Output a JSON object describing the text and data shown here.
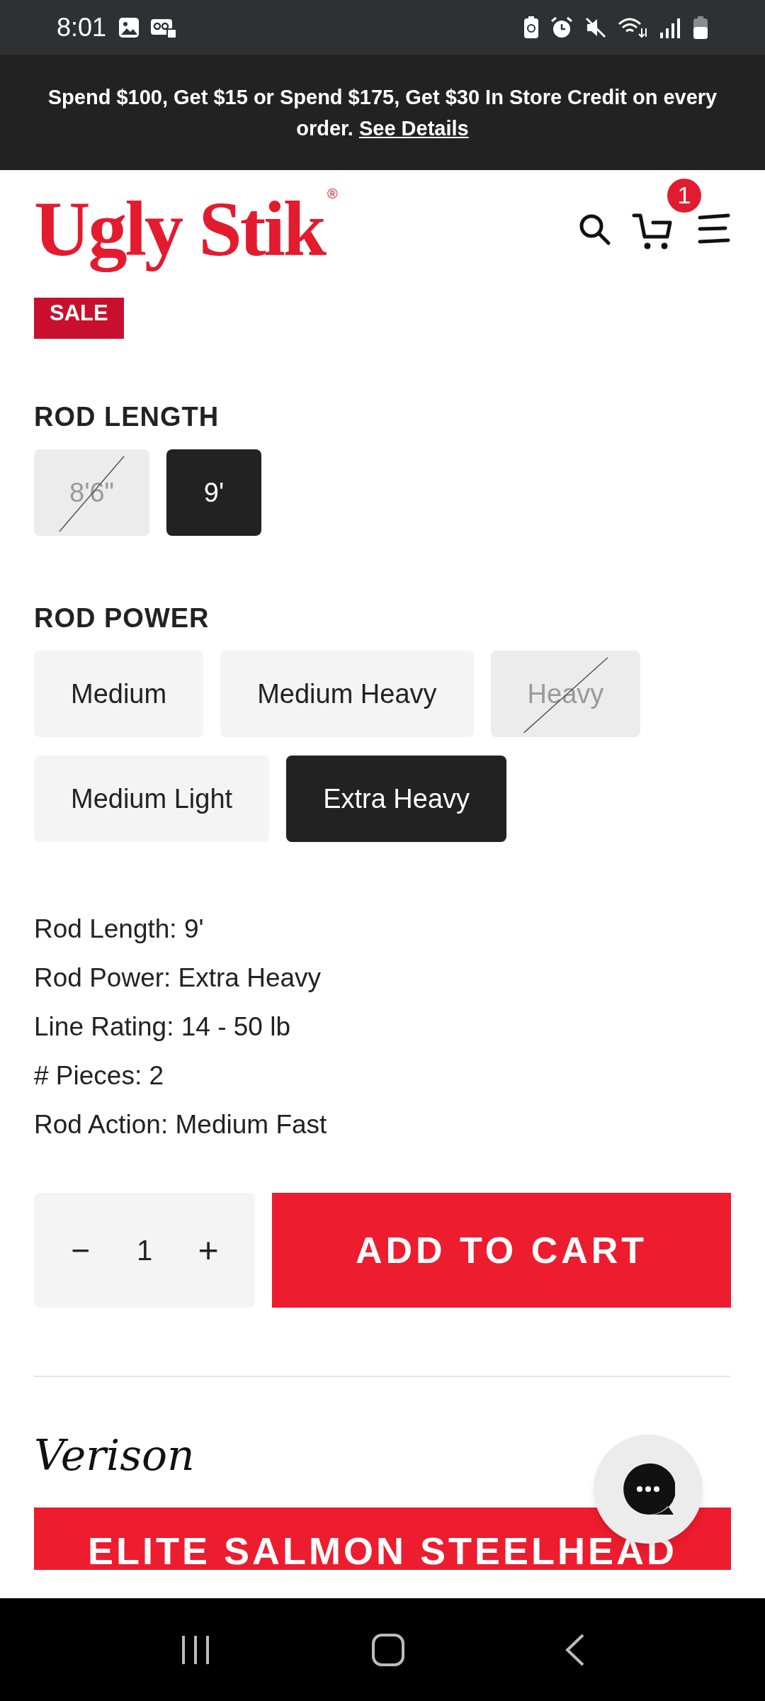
{
  "status_bar": {
    "time": "8:01"
  },
  "promo": {
    "text": "Spend $100, Get $15 or Spend $175, Get $30 In Store Credit on every order.",
    "link": "See Details"
  },
  "header": {
    "logo": "Ugly Stik",
    "logo_mark": "®",
    "cart_count": "1"
  },
  "badge": "SALE",
  "option_groups": [
    {
      "label": "ROD LENGTH",
      "options": [
        {
          "label": "8'6\"",
          "selected": false,
          "available": false
        },
        {
          "label": "9'",
          "selected": true,
          "available": true
        }
      ]
    },
    {
      "label": "ROD POWER",
      "options": [
        {
          "label": "Medium",
          "selected": false,
          "available": true
        },
        {
          "label": "Medium Heavy",
          "selected": false,
          "available": true
        },
        {
          "label": "Heavy",
          "selected": false,
          "available": false
        },
        {
          "label": "Medium Light",
          "selected": false,
          "available": true
        },
        {
          "label": "Extra Heavy",
          "selected": true,
          "available": true
        }
      ]
    }
  ],
  "specs": [
    "Rod Length: 9'",
    "Rod Power: Extra Heavy",
    "Line Rating: 14 - 50 lb",
    "# Pieces: 2",
    "Rod Action: Medium Fast"
  ],
  "quantity": {
    "minus": "−",
    "value": "1",
    "plus": "+"
  },
  "add_to_cart": "ADD TO CART",
  "section_title": "Verison",
  "banner": "ELITE SALMON STEELHEAD"
}
